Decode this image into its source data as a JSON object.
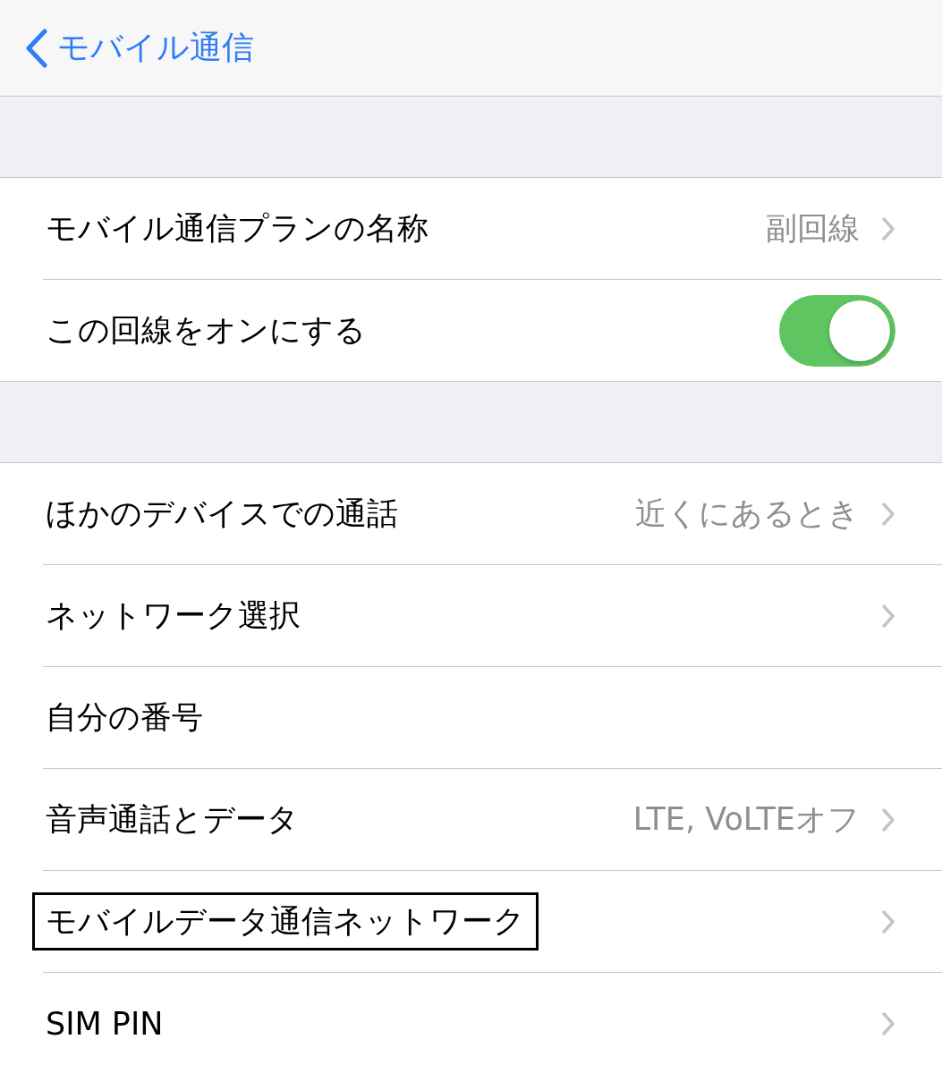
{
  "nav": {
    "back_label": "モバイル通信"
  },
  "groups": [
    {
      "rows": [
        {
          "kind": "link",
          "label": "モバイル通信プランの名称",
          "value": "副回線",
          "highlighted": false
        },
        {
          "kind": "toggle",
          "label": "この回線をオンにする",
          "on": true,
          "highlighted": false
        }
      ]
    },
    {
      "rows": [
        {
          "kind": "link",
          "label": "ほかのデバイスでの通話",
          "value": "近くにあるとき",
          "highlighted": false
        },
        {
          "kind": "link",
          "label": "ネットワーク選択",
          "highlighted": false
        },
        {
          "kind": "plain",
          "label": "自分の番号",
          "highlighted": false
        },
        {
          "kind": "link",
          "label": "音声通話とデータ",
          "value": "LTE, VoLTEオフ",
          "highlighted": false
        },
        {
          "kind": "link",
          "label": "モバイルデータ通信ネットワーク",
          "highlighted": true
        },
        {
          "kind": "link",
          "label": "SIM PIN",
          "highlighted": false
        }
      ]
    }
  ]
}
